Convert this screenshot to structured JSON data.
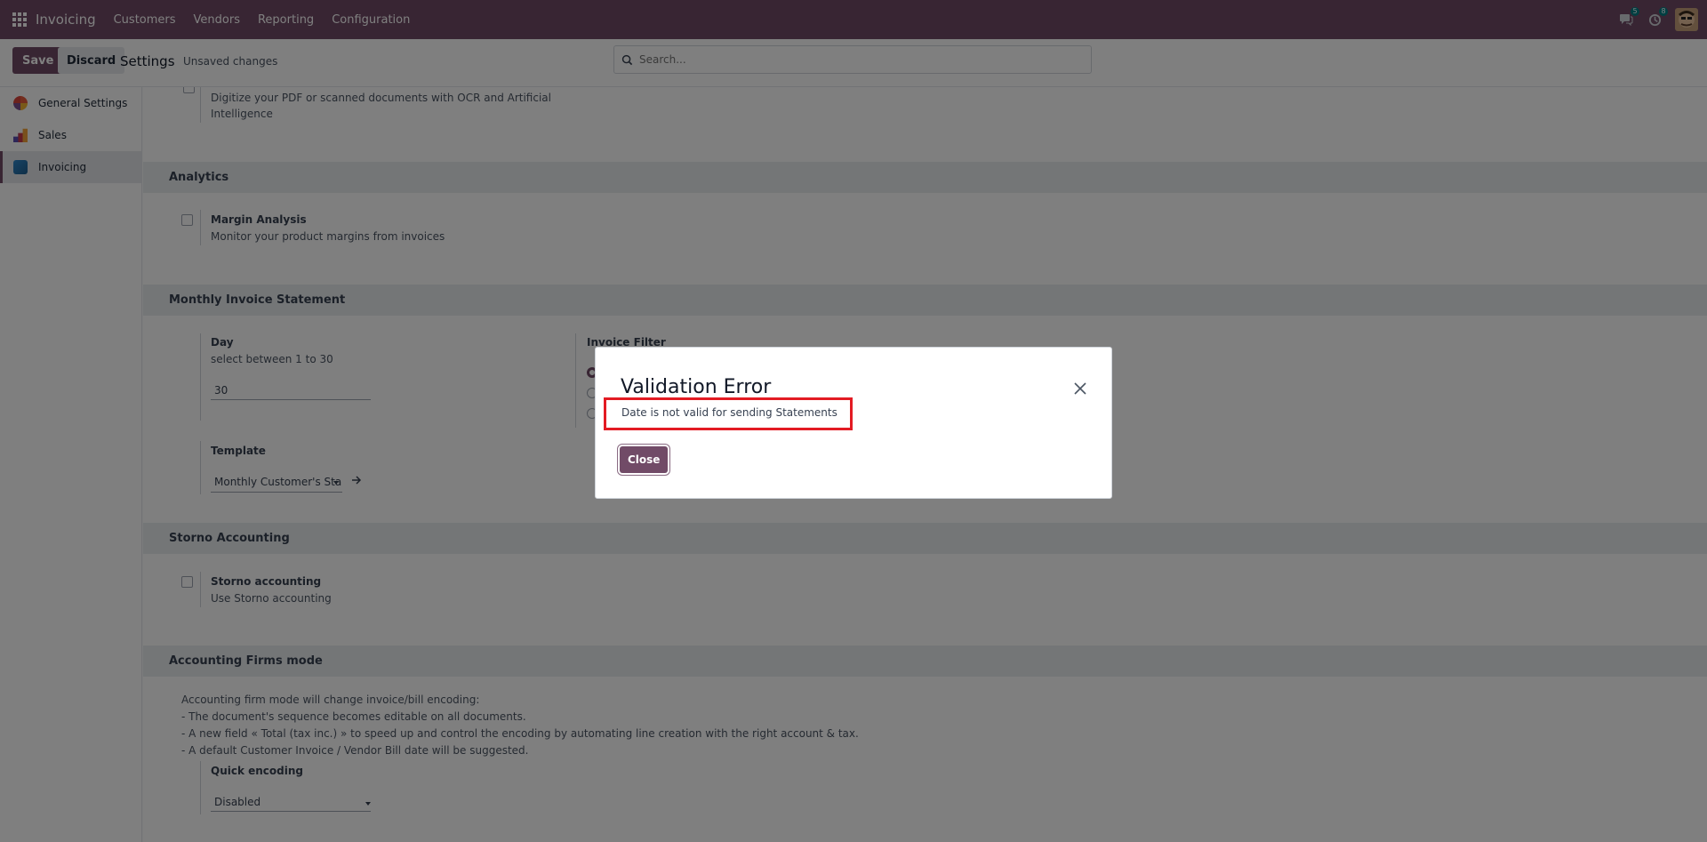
{
  "navbar": {
    "brand": "Invoicing",
    "menu": [
      "Customers",
      "Vendors",
      "Reporting",
      "Configuration"
    ],
    "messages_badge": "5",
    "activities_badge": "8"
  },
  "control_panel": {
    "save_label": "Save",
    "discard_label": "Discard",
    "title": "Settings",
    "status": "Unsaved changes",
    "search_placeholder": "Search..."
  },
  "sidebar": {
    "items": [
      {
        "label": "General Settings",
        "color": "#e65a3c"
      },
      {
        "label": "Sales",
        "color": "#c7384b"
      },
      {
        "label": "Invoicing",
        "color": "#3b82c4"
      }
    ]
  },
  "main": {
    "ocr_desc_line1": "Digitize your PDF or scanned documents with OCR and Artificial",
    "ocr_desc_line2": "Intelligence",
    "analytics": {
      "header": "Analytics",
      "margin_title": "Margin Analysis",
      "margin_desc": "Monitor your product margins from invoices"
    },
    "monthly": {
      "header": "Monthly Invoice Statement",
      "day_label": "Day",
      "day_desc": "select between 1 to 30",
      "day_value": "30",
      "filter_label": "Invoice Filter",
      "template_label": "Template",
      "template_value": "Monthly Customer's Sta"
    },
    "storno": {
      "header": "Storno Accounting",
      "title": "Storno accounting",
      "desc": "Use Storno accounting"
    },
    "firms": {
      "header": "Accounting Firms mode",
      "line1": "Accounting firm mode will change invoice/bill encoding:",
      "line2": "- The document's sequence becomes editable on all documents.",
      "line3": "- A new field « Total (tax inc.) » to speed up and control the encoding by automating line creation with the right account & tax.",
      "line4": "- A default Customer Invoice / Vendor Bill date will be suggested.",
      "quick_label": "Quick encoding",
      "quick_value": "Disabled"
    }
  },
  "dialog": {
    "title": "Validation Error",
    "message": "Date is not valid for sending Statements",
    "close_label": "Close"
  },
  "colors": {
    "brand": "#714b67",
    "highlight": "#e31b23"
  }
}
